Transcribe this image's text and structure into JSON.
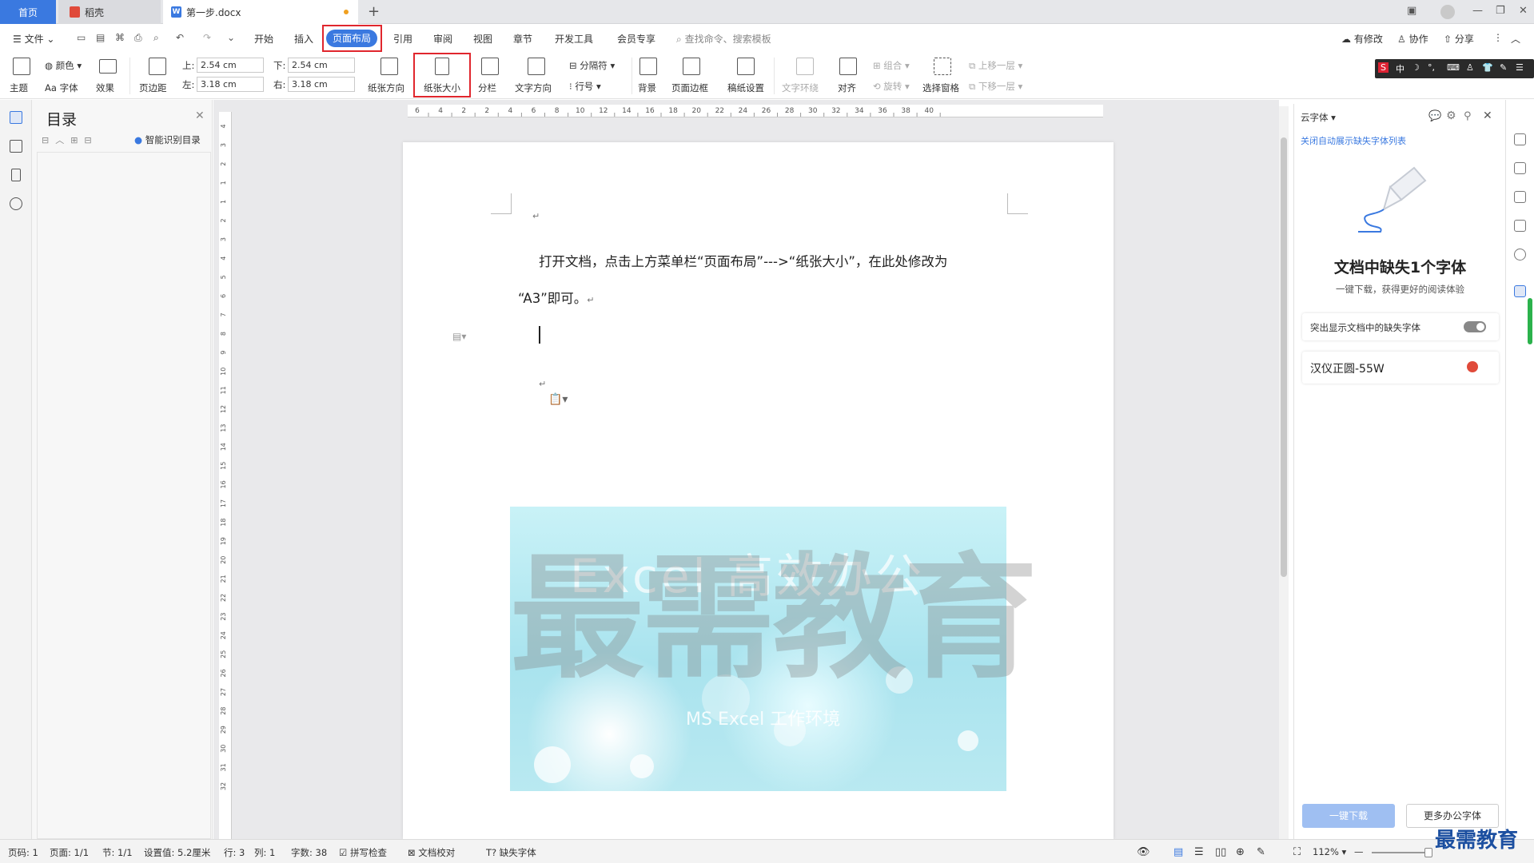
{
  "tabs": {
    "home": "首页",
    "doc2": "稻壳",
    "active": "第一步.docx",
    "add": "+"
  },
  "menu": {
    "file": "文件",
    "items": [
      "开始",
      "插入",
      "页面布局",
      "引用",
      "审阅",
      "视图",
      "章节",
      "开发工具",
      "会员专享"
    ],
    "search": "查找命令、搜索模板",
    "modified": "有修改",
    "collab": "协作",
    "share": "分享"
  },
  "ribbon": {
    "theme": "主题",
    "color": "颜色",
    "font": "Aa 字体",
    "effect": "效果",
    "margin": "页边距",
    "top_label": "上:",
    "top_val": "2.54 cm",
    "bottom_label": "下:",
    "bottom_val": "2.54 cm",
    "left_label": "左:",
    "left_val": "3.18 cm",
    "right_label": "右:",
    "right_val": "3.18 cm",
    "orientation": "纸张方向",
    "paper_size": "纸张大小",
    "columns": "分栏",
    "text_dir": "文字方向",
    "separator": "分隔符",
    "line_num": "行号",
    "background": "背景",
    "page_border": "页面边框",
    "manuscript": "稿纸设置",
    "text_wrap": "文字环绕",
    "align": "对齐",
    "group": "组合",
    "rotate": "旋转",
    "select_pane": "选择窗格",
    "move_up": "上移一层",
    "move_down": "下移一层"
  },
  "toc": {
    "title": "目录",
    "smart": "智能识别目录"
  },
  "ruler": {
    "h_ticks": [
      "6",
      "4",
      "2",
      "2",
      "4",
      "6",
      "8",
      "10",
      "12",
      "14",
      "16",
      "18",
      "20",
      "22",
      "24",
      "26",
      "28",
      "30",
      "32",
      "34",
      "36",
      "38",
      "40"
    ],
    "v_ticks": [
      "4",
      "3",
      "2",
      "1",
      "1",
      "2",
      "3",
      "4",
      "5",
      "6",
      "7",
      "8",
      "9",
      "10",
      "11",
      "12",
      "13",
      "14",
      "15",
      "16",
      "17",
      "18",
      "19",
      "20",
      "21",
      "22",
      "23",
      "24",
      "25",
      "26",
      "27",
      "28",
      "29",
      "30",
      "31",
      "32"
    ]
  },
  "document": {
    "line1": "打开文档，点击上方菜单栏“页面布局”--->“纸张大小”，在此处修改为",
    "line2": "“A3”即可。",
    "banner_en": "Excel 高效办公",
    "banner_sub": "MS Excel 工作环境",
    "watermark": "最需教育"
  },
  "right_panel": {
    "header": "云字体",
    "link": "关闭自动展示缺失字体列表",
    "title": "文档中缺失1个字体",
    "subtitle": "一键下载，获得更好的阅读体验",
    "toggle_label": "突出显示文档中的缺失字体",
    "font_name": "汉仪正圆-55W",
    "btn_download": "一键下载",
    "btn_more": "更多办公字体"
  },
  "status": {
    "page": "页码: 1",
    "pages": "页面: 1/1",
    "section": "节: 1/1",
    "setting": "设置值: 5.2厘米",
    "row": "行: 3",
    "col": "列: 1",
    "words": "字数: 38",
    "spell": "拼写检查",
    "proof": "文档校对",
    "missing": "缺失字体",
    "zoom": "112%"
  },
  "corner_watermark": "最需教育",
  "colors": {
    "accent": "#3a79e0",
    "highlight_box": "#e0262d"
  }
}
